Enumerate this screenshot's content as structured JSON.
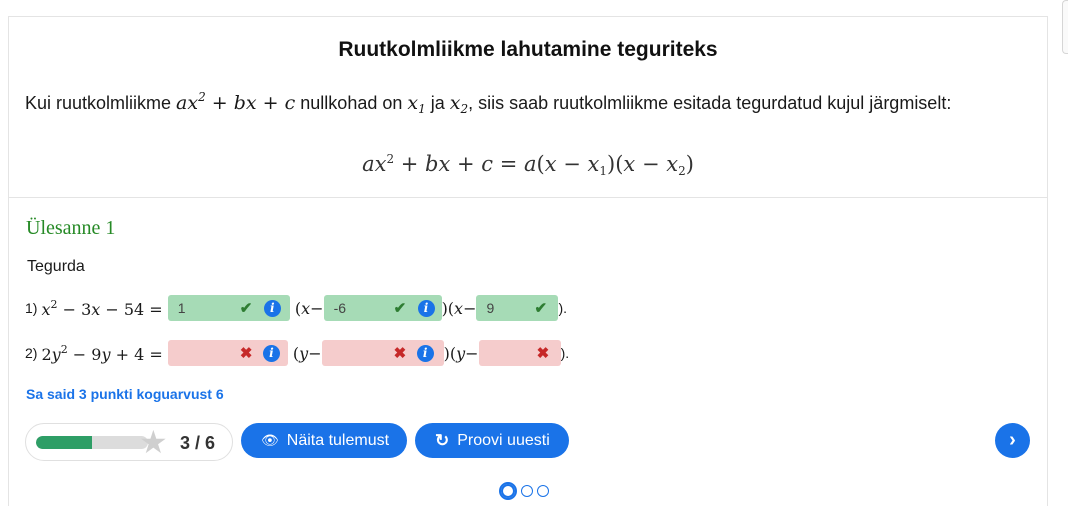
{
  "intro": {
    "title": "Ruutkolmliikme lahutamine teguriteks",
    "text_part1": "Kui ruutkolmliikme ",
    "text_part2": " nullkohad on ",
    "text_part3": " ja ",
    "text_part4": ", siis saab ruutkolmliikme esitada tegurdatud kujul järgmiselt:"
  },
  "exercise": {
    "title": "Ülesanne 1",
    "instruction": "Tegurda",
    "rows": [
      {
        "label": "1)",
        "blanks": [
          {
            "value": "1",
            "status": "correct"
          },
          {
            "value": "-6",
            "status": "correct"
          },
          {
            "value": "9",
            "status": "correct"
          }
        ]
      },
      {
        "label": "2)",
        "blanks": [
          {
            "value": "",
            "status": "incorrect"
          },
          {
            "value": "",
            "status": "incorrect"
          },
          {
            "value": "",
            "status": "incorrect"
          }
        ]
      }
    ],
    "closing": ")."
  },
  "score_text": "Sa said 3 punkti koguarvust 6",
  "progress": {
    "text": "3 / 6",
    "fraction": 0.5
  },
  "buttons": {
    "show_result": "Näita tulemust",
    "retry": "Proovi uuesti"
  },
  "pagination": {
    "total": 3,
    "current": 1
  },
  "icons": {
    "correct": "check-icon",
    "incorrect": "cross-icon",
    "info": "info-icon",
    "eye": "eye-icon",
    "retry": "retry-icon",
    "next": "chevron-right-icon",
    "star": "star-icon"
  },
  "colors": {
    "accent": "#1a73e8",
    "correct_bg": "#a6dbb6",
    "incorrect_bg": "#f5cccc",
    "exercise_title": "#268a26",
    "progress_fill": "#2e9e66"
  }
}
